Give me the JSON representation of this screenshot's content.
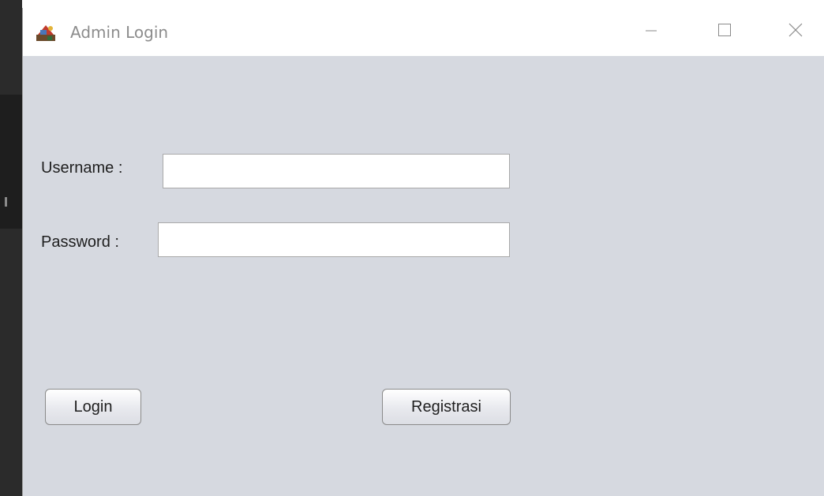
{
  "window": {
    "title": "Admin Login",
    "app_icon": "java-cup-icon",
    "controls": {
      "minimize": "minimize-icon",
      "maximize": "maximize-icon",
      "close": "close-icon"
    }
  },
  "form": {
    "username_label": "Username :",
    "username_value": "",
    "password_label": "Password :",
    "password_value": ""
  },
  "buttons": {
    "login": "Login",
    "register": "Registrasi"
  },
  "colors": {
    "window_background": "#d6d9e0",
    "titlebar": "#ffffff",
    "title_text": "#8c8c8c"
  }
}
